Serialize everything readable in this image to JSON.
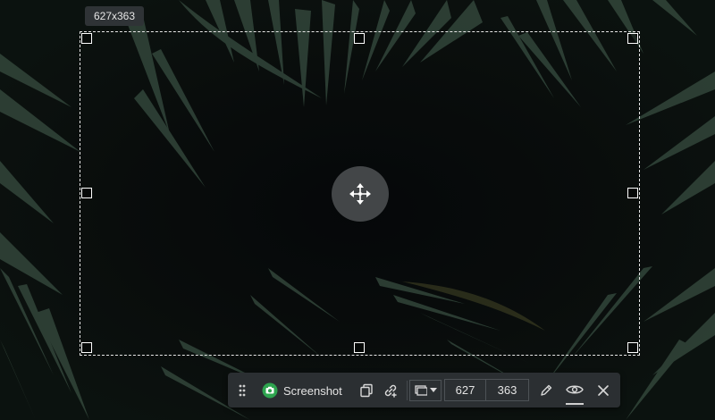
{
  "overlay": {
    "size_readout": "627x363"
  },
  "toolbar": {
    "mode_label": "Screenshot",
    "width_value": "627",
    "height_value": "363"
  },
  "colors": {
    "toolbar_bg": "#2b2f32",
    "accent_green": "#2ea44f",
    "selection_border": "#e8e8e8"
  },
  "icons": {
    "drag": "drag-handle-icon",
    "camera": "camera-icon",
    "copy": "copy-icon",
    "link": "share-link-icon",
    "capture_mode": "capture-area-icon",
    "dropdown": "chevron-down-icon",
    "edit": "pencil-icon",
    "preview": "eye-icon",
    "close": "close-icon",
    "move": "move-icon"
  }
}
